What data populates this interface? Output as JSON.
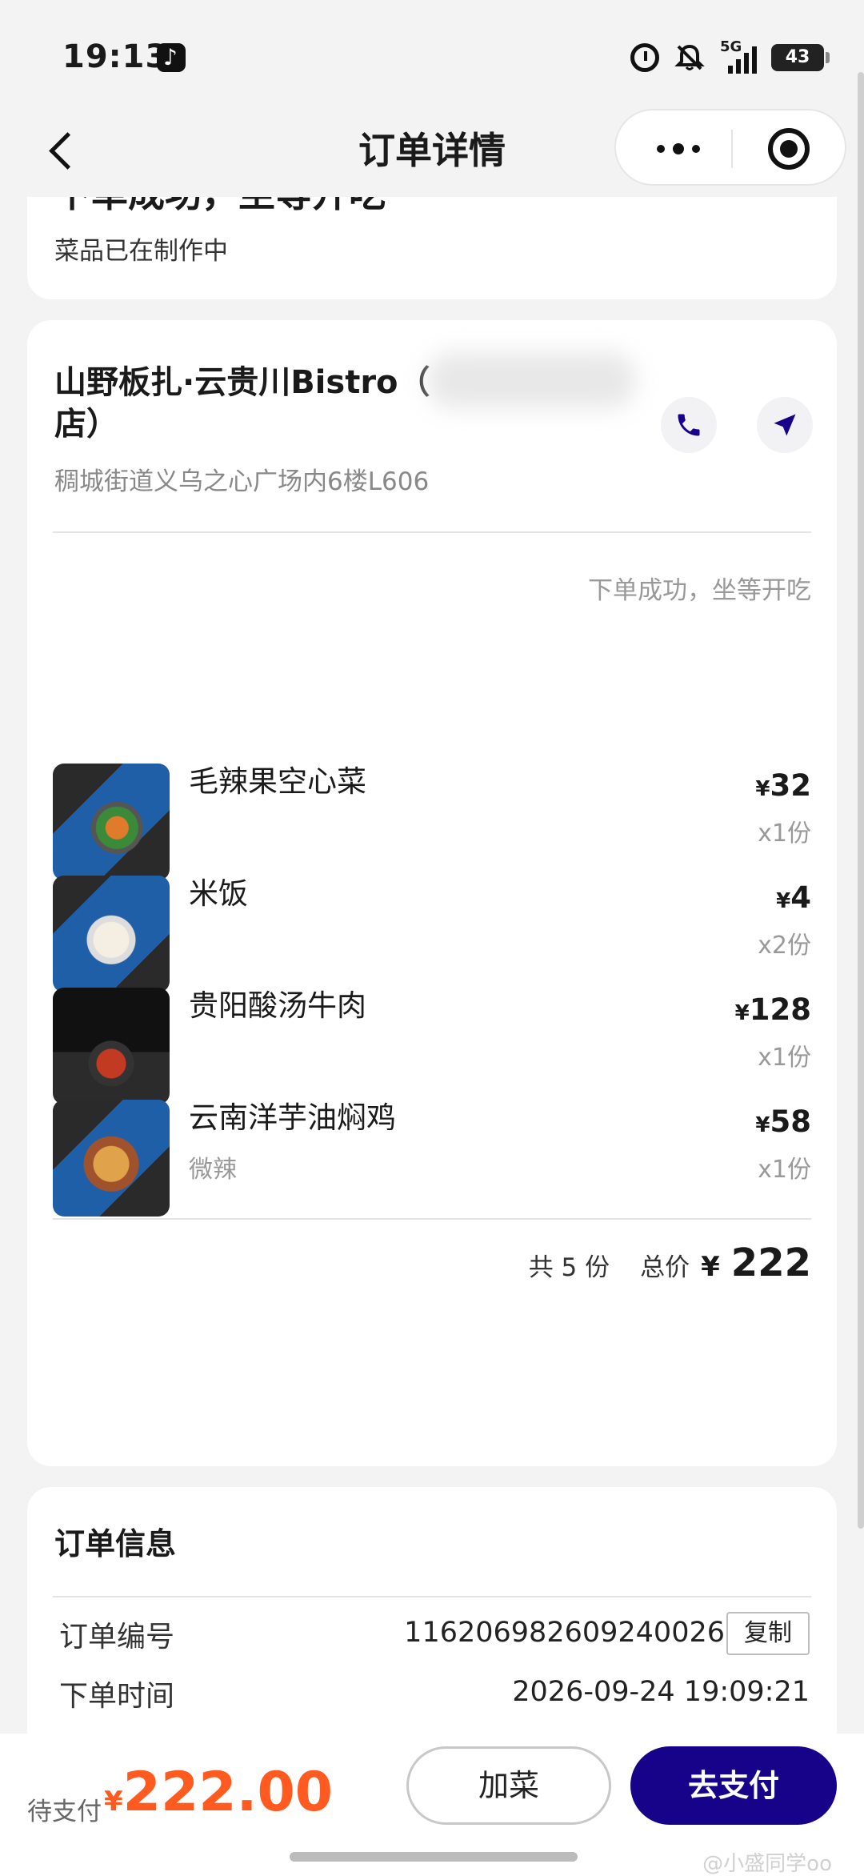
{
  "status_bar": {
    "time": "19:13",
    "network": "5G",
    "battery": "43",
    "icons": [
      "tiktok-icon",
      "alarm-icon",
      "bell-muted-icon",
      "signal-icon",
      "battery-icon"
    ]
  },
  "nav": {
    "title": "订单详情",
    "back_icon": "chevron-left-icon",
    "more_icon": "more-dots-icon",
    "close_icon": "target-icon"
  },
  "status_card": {
    "title": "下单成功，坐等开吃",
    "subtitle": "菜品已在制作中"
  },
  "store": {
    "name": "山野板扎·云贵川Bistro（",
    "name_line2": "店）",
    "address": "稠城街道义乌之心广场内6楼L606",
    "phone_icon": "phone-icon",
    "navigate_icon": "navigation-arrow-icon",
    "order_status": "下单成功，坐等开吃"
  },
  "dishes": [
    {
      "name": "毛辣果空心菜",
      "spec": "",
      "currency": "¥",
      "price": "32",
      "qty": "x1份"
    },
    {
      "name": "米饭",
      "spec": "",
      "currency": "¥",
      "price": "4",
      "qty": "x2份"
    },
    {
      "name": "贵阳酸汤牛肉",
      "spec": "",
      "currency": "¥",
      "price": "128",
      "qty": "x1份"
    },
    {
      "name": "云南洋芋油焖鸡",
      "spec": "微辣",
      "currency": "¥",
      "price": "58",
      "qty": "x1份"
    }
  ],
  "total": {
    "count_text": "共 5 份",
    "label": "总价",
    "currency": "¥",
    "value": "222"
  },
  "order_info": {
    "title": "订单信息",
    "order_no_label": "订单编号",
    "order_no": "116206982609240026",
    "copy_label": "复制",
    "time_label": "下单时间",
    "time": "2026-09-24 19:09:21"
  },
  "bottom": {
    "pay_label": "待支付",
    "currency": "¥",
    "amount": "222.00",
    "add_button": "加菜",
    "pay_button": "去支付"
  },
  "watermark": "@小盛同学oo",
  "colors": {
    "accent": "#17038a",
    "price_highlight": "#ff5a1f",
    "background": "#f3f3f3"
  }
}
